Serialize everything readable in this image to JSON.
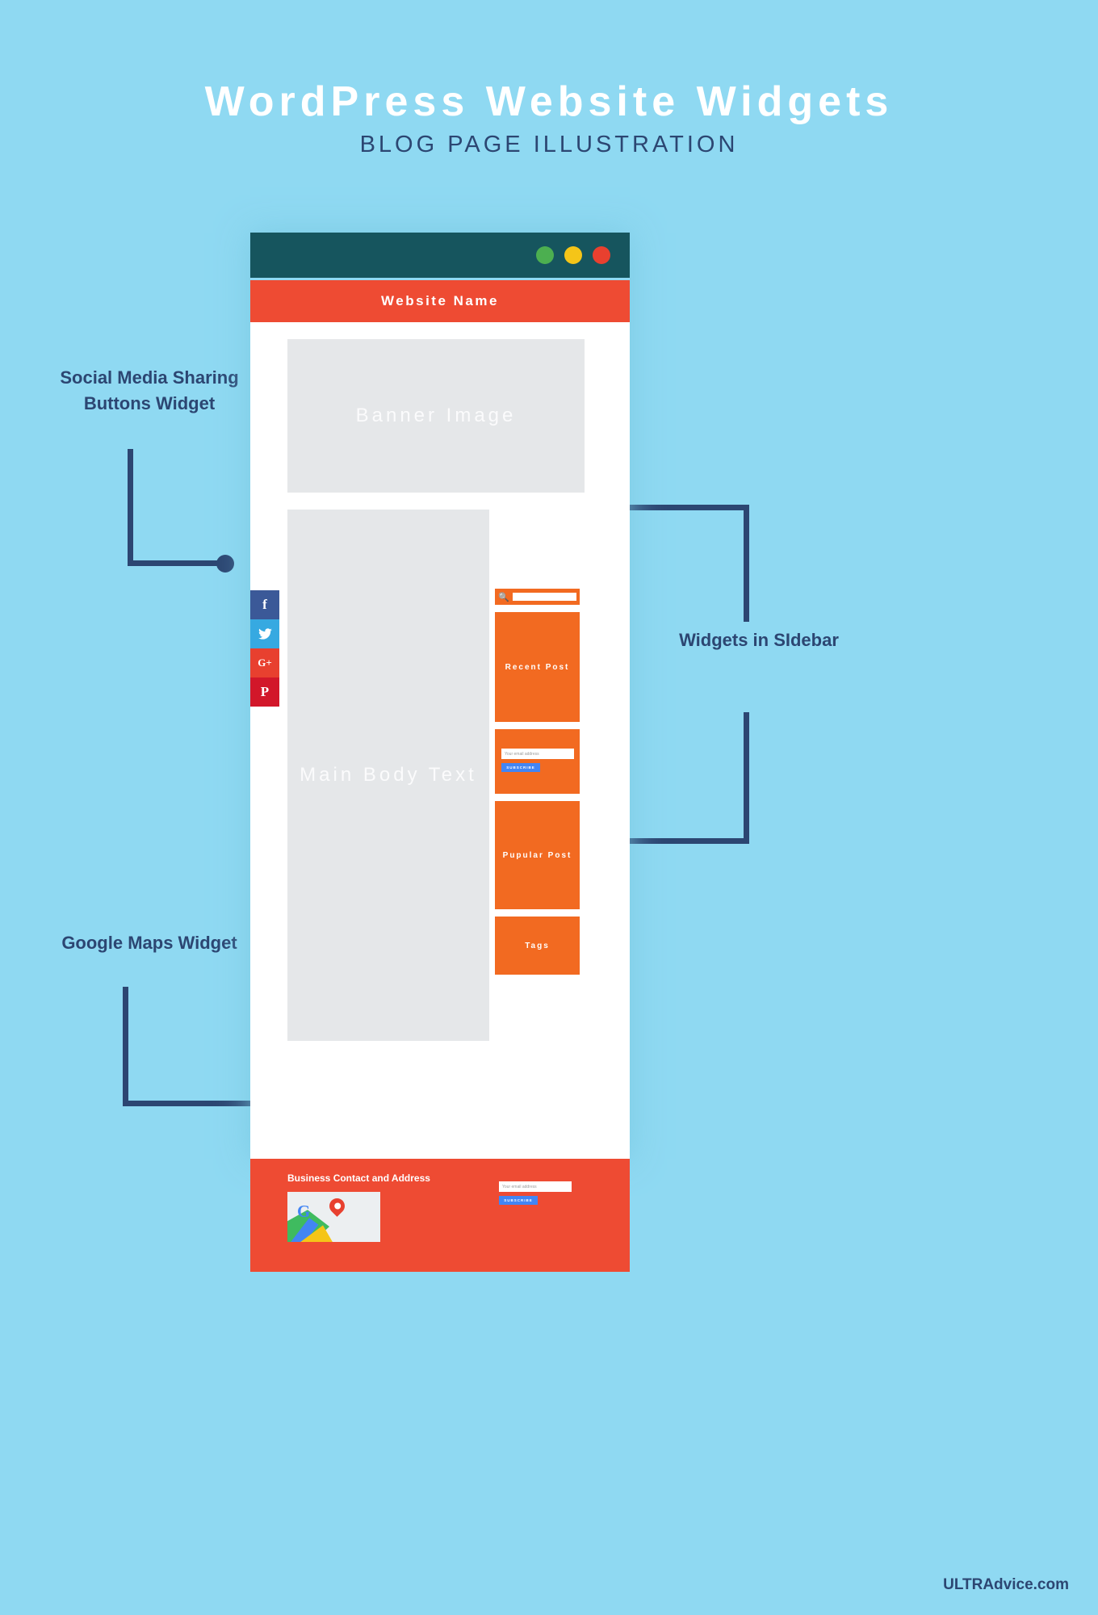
{
  "header": {
    "title": "WordPress Website Widgets",
    "subtitle": "BLOG PAGE ILLUSTRATION"
  },
  "browser": {
    "window_dots": [
      "green",
      "yellow",
      "red"
    ],
    "site_name": "Website Name",
    "banner_label": "Banner Image",
    "body_label": "Main Body Text"
  },
  "social_widget": {
    "buttons": [
      {
        "name": "facebook",
        "glyph": "f",
        "color": "#3b5998"
      },
      {
        "name": "twitter",
        "glyph": "✐",
        "color": "#36a9e1"
      },
      {
        "name": "google-plus",
        "glyph": "G+",
        "color": "#e8402f"
      },
      {
        "name": "pinterest",
        "glyph": "P",
        "color": "#d2172a"
      }
    ]
  },
  "sidebar": {
    "search": {
      "icon": "search-icon",
      "value": ""
    },
    "widgets": [
      {
        "id": "recent-post",
        "label": "Recent Post"
      },
      {
        "id": "subscribe",
        "label": ""
      },
      {
        "id": "popular-post",
        "label": "Pupular Post"
      },
      {
        "id": "tags",
        "label": "Tags"
      }
    ],
    "subscribe": {
      "email_placeholder": "Your email address",
      "button_label": "SUBSCRIBE"
    }
  },
  "footer": {
    "contact_title": "Business Contact and Address",
    "map_icon": "google-maps-icon",
    "email_placeholder": "Your email address",
    "button_label": "SUBSCRIBE"
  },
  "annotations": [
    {
      "id": "social",
      "text": "Social Media Sharing Buttons Widget"
    },
    {
      "id": "sidebar",
      "text": "Widgets in SIdebar"
    },
    {
      "id": "maps",
      "text": "Google Maps Widget"
    }
  ],
  "credit": "ULTRAdvice.com",
  "colors": {
    "background": "#8fd9f2",
    "navy": "#2c4672",
    "teal": "#16555e",
    "red": "#ee4b33",
    "orange": "#f26a21",
    "gray": "#e5e7e9",
    "blue_button": "#4285f4"
  }
}
